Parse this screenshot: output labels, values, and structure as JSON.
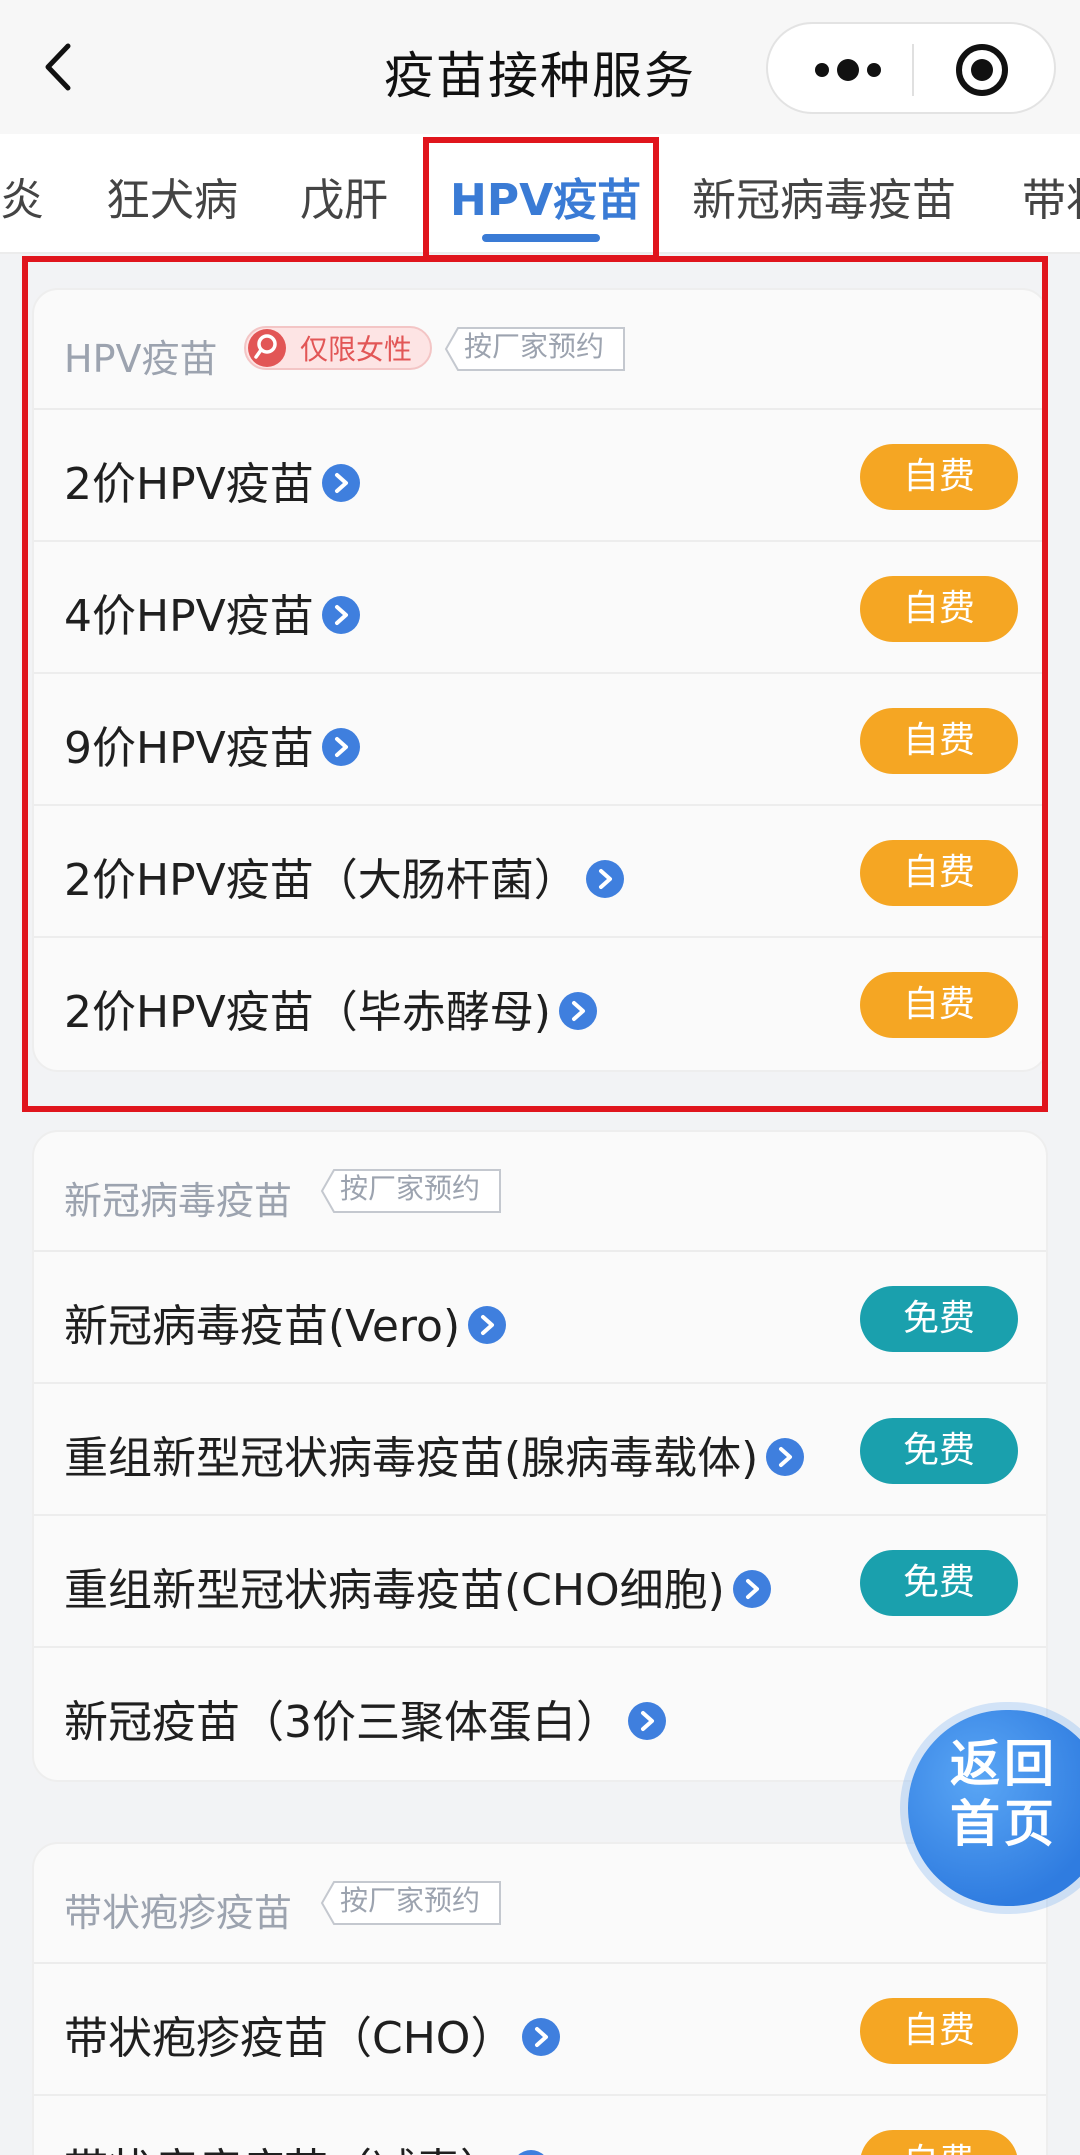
{
  "header": {
    "title": "疫苗接种服务",
    "icons": [
      "chevron-left-icon",
      "more-dots-icon",
      "target-icon"
    ]
  },
  "tabs": [
    {
      "label": "炎"
    },
    {
      "label": "狂犬病"
    },
    {
      "label": "戊肝"
    },
    {
      "label": "HPV疫苗",
      "active": true
    },
    {
      "label": "新冠病毒疫苗"
    },
    {
      "label": "带状"
    }
  ],
  "sections": [
    {
      "title": "HPV疫苗",
      "female_tag": "仅限女性",
      "maker_tag": "按厂家预约",
      "rows": [
        {
          "label": "2价HPV疫苗",
          "fee": "自费"
        },
        {
          "label": "4价HPV疫苗",
          "fee": "自费"
        },
        {
          "label": "9价HPV疫苗",
          "fee": "自费"
        },
        {
          "label": "2价HPV疫苗（大肠杆菌）",
          "fee": "自费"
        },
        {
          "label": "2价HPV疫苗（毕赤酵母)",
          "fee": "自费"
        }
      ]
    },
    {
      "title": "新冠病毒疫苗",
      "maker_tag": "按厂家预约",
      "rows": [
        {
          "label": "新冠病毒疫苗(Vero)",
          "fee": "免费"
        },
        {
          "label": "重组新型冠状病毒疫苗(腺病毒载体)",
          "fee": "免费"
        },
        {
          "label": "重组新型冠状病毒疫苗(CHO细胞)",
          "fee": "免费"
        },
        {
          "label": "新冠疫苗（3价三聚体蛋白）",
          "fee": ""
        }
      ]
    },
    {
      "title": "带状疱疹疫苗",
      "maker_tag": "按厂家预约",
      "rows": [
        {
          "label": "带状疱疹疫苗（CHO）",
          "fee": "自费"
        },
        {
          "label": "带状疱疹疫苗（减毒）",
          "fee": "自费"
        }
      ]
    }
  ],
  "home_button": {
    "line1": "返回",
    "line2": "首页"
  },
  "colors": {
    "accent": "#3a7bd5",
    "self_pay": "#f5a623",
    "free": "#1aa0ad",
    "highlight": "#e0151d"
  }
}
